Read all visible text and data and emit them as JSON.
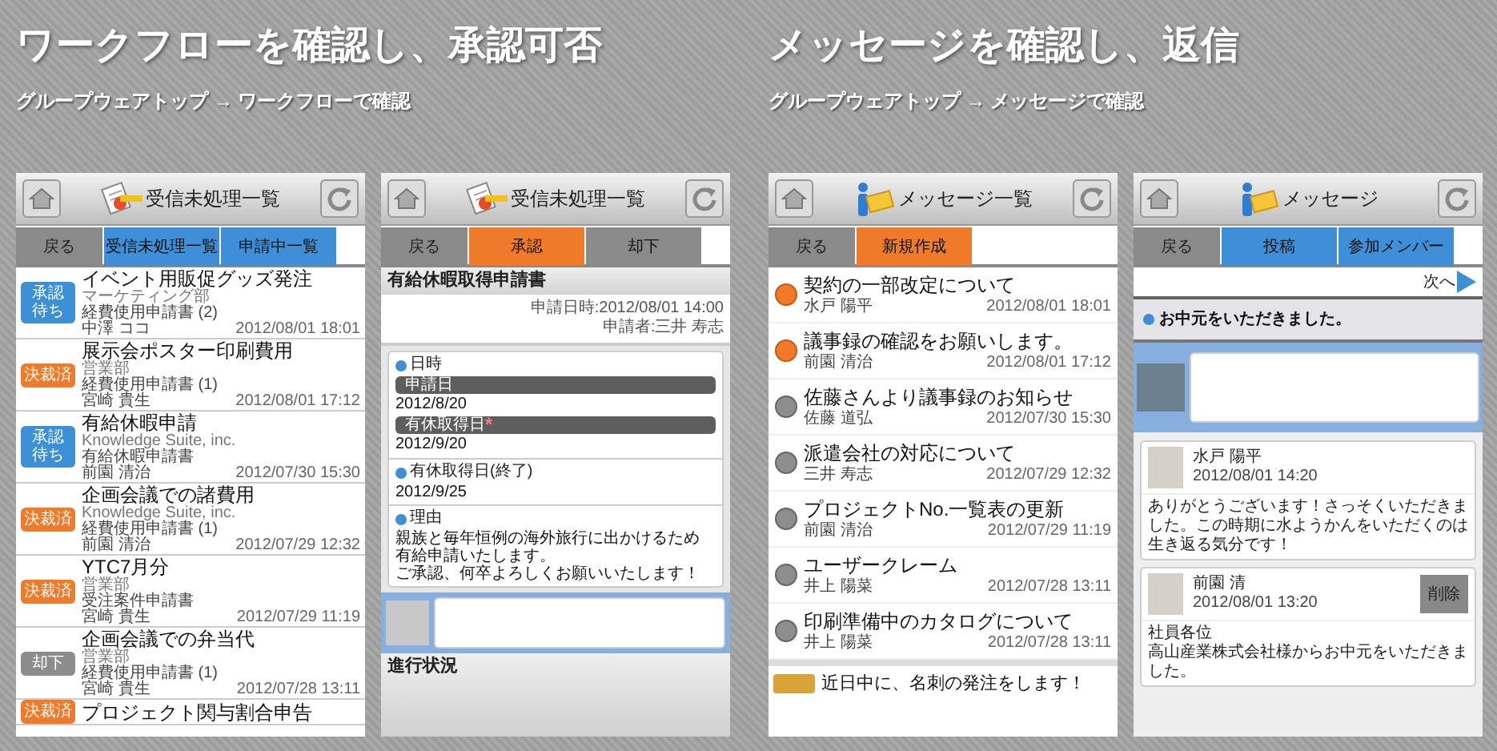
{
  "sections": [
    {
      "title": "ワークフローを確認し、承認可否",
      "breadcrumb": "グループウェアトップ → ワークフローで確認"
    },
    {
      "title": "メッセージを確認し、返信",
      "breadcrumb": "グループウェアトップ → メッセージで確認"
    }
  ],
  "workflow_list": {
    "header_title": "受信未処理一覧",
    "buttons": [
      {
        "label": "戻る",
        "color": "#8a8a8a"
      },
      {
        "label": "受信未処理一覧",
        "color": "#3f8fd8"
      },
      {
        "label": "申請中一覧",
        "color": "#3f8fd8"
      }
    ],
    "items": [
      {
        "badge": [
          "承認",
          "待ち"
        ],
        "color": "#3d8fd6",
        "title": "イベント用販促グッズ発注",
        "org": "マーケティング部",
        "form": "経費使用申請書 (2)",
        "person": "中澤 ココ",
        "date": "2012/08/01 18:01"
      },
      {
        "badge": [
          "決裁済"
        ],
        "color": "#ee7a2a",
        "title": "展示会ポスター印刷費用",
        "org": "営業部",
        "form": "経費使用申請書 (1)",
        "person": "宮崎 貴生",
        "date": "2012/08/01 17:12"
      },
      {
        "badge": [
          "承認",
          "待ち"
        ],
        "color": "#3d8fd6",
        "title": "有給休暇申請",
        "org": "Knowledge Suite, inc.",
        "form": "有給休暇申請書",
        "person": "前園 清治",
        "date": "2012/07/30 15:30"
      },
      {
        "badge": [
          "決裁済"
        ],
        "color": "#ee7a2a",
        "title": "企画会議での諸費用",
        "org": "Knowledge Suite, inc.",
        "form": "経費使用申請書 (1)",
        "person": "前園 清治",
        "date": "2012/07/29 12:32"
      },
      {
        "badge": [
          "決裁済"
        ],
        "color": "#ee7a2a",
        "title": "YTC7月分",
        "org": "営業部",
        "form": "受注案件申請書",
        "person": "宮崎 貴生",
        "date": "2012/07/29 11:19"
      },
      {
        "badge": [
          "却下"
        ],
        "color": "#8c8c8c",
        "title": "企画会議での弁当代",
        "org": "営業部",
        "form": "経費使用申請書 (1)",
        "person": "宮崎 貴生",
        "date": "2012/07/28 13:11"
      },
      {
        "badge": [
          "決裁済"
        ],
        "color": "#ee7a2a",
        "title": "プロジェクト関与割合申告"
      }
    ]
  },
  "workflow_detail": {
    "header_title": "受信未処理一覧",
    "buttons": [
      {
        "label": "戻る",
        "color": "#8a8a8a"
      },
      {
        "label": "承認",
        "color": "#ee7a2a"
      },
      {
        "label": "却下",
        "color": "#8a8a8a"
      }
    ],
    "form_title": "有給休暇取得申請書",
    "submitted": "申請日時:2012/08/01 14:00",
    "applicant": "申請者:三井 寿志",
    "sections": [
      {
        "heading": "日時",
        "fields": [
          {
            "label": "申請日",
            "value": "2012/8/20"
          },
          {
            "label": "有休取得日",
            "required_mark": "*",
            "value": "2012/9/20"
          }
        ]
      },
      {
        "heading": "有休取得日(終了)",
        "value": "2012/9/25"
      },
      {
        "heading": "理由",
        "lines": [
          "親族と毎年恒例の海外旅行に出かけるため",
          "有給申請いたします。",
          "ご承認、何卒よろしくお願いいたします！"
        ]
      }
    ],
    "progress_title": "進行状況"
  },
  "message_list": {
    "header_title": "メッセージ一覧",
    "buttons": [
      {
        "label": "戻る",
        "color": "#8a8a8a"
      },
      {
        "label": "新規作成",
        "color": "#ee7a2a"
      }
    ],
    "items": [
      {
        "unread": true,
        "title": "契約の一部改定について",
        "person": "水戸 陽平",
        "date": "2012/08/01 18:01"
      },
      {
        "unread": true,
        "title": "議事録の確認をお願いします。",
        "person": "前園 清治",
        "date": "2012/08/01 17:12"
      },
      {
        "unread": false,
        "title": "佐藤さんより議事録のお知らせ",
        "person": "佐藤 道弘",
        "date": "2012/07/30 15:30"
      },
      {
        "unread": false,
        "title": "派遣会社の対応について",
        "person": "三井 寿志",
        "date": "2012/07/29 12:32"
      },
      {
        "unread": false,
        "title": "プロジェクトNo.一覧表の更新",
        "person": "前園 清治",
        "date": "2012/07/29 11:19"
      },
      {
        "unread": false,
        "title": "ユーザークレーム",
        "person": "井上 陽菜",
        "date": "2012/07/28 13:11"
      },
      {
        "unread": false,
        "title": "印刷準備中のカタログについて",
        "person": "井上 陽菜",
        "date": "2012/07/28 13:11"
      }
    ],
    "notice": "近日中に、名刺の発注をします！"
  },
  "message_thread": {
    "header_title": "メッセージ",
    "buttons": [
      {
        "label": "戻る",
        "color": "#8a8a8a"
      },
      {
        "label": "投稿",
        "color": "#3f8fd8"
      },
      {
        "label": "参加メンバー",
        "color": "#3f8fd8"
      }
    ],
    "next_link": "次へ",
    "subject": "お中元をいただきました。",
    "posts": [
      {
        "name": "水戸 陽平",
        "date": "2012/08/01 14:20",
        "body": [
          "ありがとうございます！さっそくいただきました。この時期に水ようかんをいただくのは生き返る気分です！"
        ]
      },
      {
        "name": "前園 清",
        "date": "2012/08/01 13:20",
        "delete_label": "削除",
        "body": [
          "社員各位",
          "高山産業株式会社様からお中元をいただきました。"
        ]
      }
    ]
  }
}
